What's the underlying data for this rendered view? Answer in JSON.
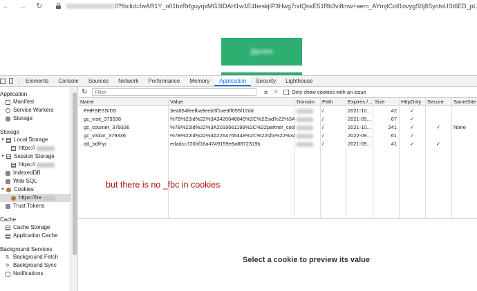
{
  "browser": {
    "url": "0?fbclid=IwAR1Y_o01bzRrfguyqxMG3IDAH1w1E4beskjIP3Hwg7rxIQnxE51Rb3vi8mw+aem_AYmjtColl1ovygS0j8SyofoUSt6ED_pL_jfSO6ZaFsIDyei..."
  },
  "page": {
    "button_label": "Далее"
  },
  "devtools": {
    "tabs": [
      "Elements",
      "Console",
      "Sources",
      "Network",
      "Performance",
      "Memory",
      "Application",
      "Security",
      "Lighthouse"
    ],
    "active_tab": "Application"
  },
  "sidebar": {
    "application_header": "Application",
    "application_items": [
      "Manifest",
      "Service Workers",
      "Storage"
    ],
    "storage_header": "Storage",
    "local_storage": "Local Storage",
    "local_storage_child": "https://",
    "session_storage": "Session Storage",
    "session_storage_child": "https://",
    "indexeddb": "IndexedDB",
    "websql": "Web SQL",
    "cookies": "Cookies",
    "cookies_child": "https://he",
    "trust_tokens": "Trust Tokens",
    "cache_header": "Cache",
    "cache_items": [
      "Cache Storage",
      "Application Cache"
    ],
    "background_header": "Background Services",
    "background_items": [
      "Background Fetch",
      "Background Sync",
      "Notifications"
    ]
  },
  "toolbar": {
    "filter_placeholder": "Filter",
    "only_issues_label": "Only show cookies with an issue"
  },
  "table": {
    "headers": [
      "Name",
      "Value",
      "Domain",
      "Path",
      "Expires /...",
      "Size",
      "HttpOnly",
      "Secure",
      "SameSite"
    ],
    "rows": [
      [
        "PHPSESSID5",
        "3ea654feefba9eeb5f1ae3ff055f12dd",
        "",
        "/",
        "2021-10...",
        "42",
        "✓",
        "",
        ""
      ],
      [
        "gc_visit_379336",
        "%7B%22id%22%3A3420046849%2C%22sid%22%3A2...",
        "",
        "/",
        "2021-09...",
        "67",
        "✓",
        "",
        ""
      ],
      [
        "gc_counter_379336",
        "%7B%22id%22%3A2019561199%2C%22partner_code...",
        "",
        "/",
        "2021-10...",
        "241",
        "✓",
        "✓",
        "None"
      ],
      [
        "gc_visitor_379336",
        "%7B%22id%22%3A2264765448%2C%22sfix%22%3A1...",
        "",
        "/",
        "2022-09...",
        "61",
        "✓",
        "",
        ""
      ],
      [
        "dd_bdfhyr",
        "edadcc720bf16a4749159e8a8872319b",
        "",
        "/",
        "2021-09...",
        "41",
        "✓",
        "✓",
        ""
      ]
    ]
  },
  "annotation": "but there is no _fbc in cookies",
  "preview": {
    "message": "Select a cookie to preview its value"
  }
}
